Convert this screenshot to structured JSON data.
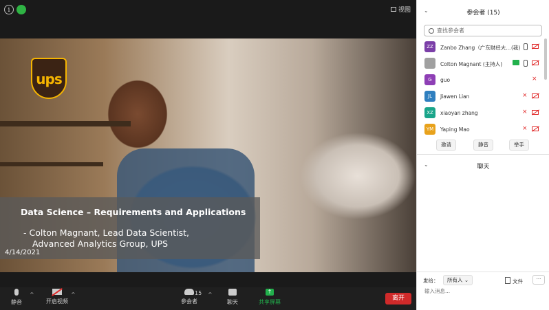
{
  "topbar": {
    "view_label": "视图"
  },
  "slide": {
    "logo_text": "ups",
    "title": "Data Science – Requirements and Applications",
    "subtitle_line1": "- Colton Magnant, Lead Data Scientist,",
    "subtitle_line2": "Advanced Analytics Group, UPS",
    "date": "4/14/2021"
  },
  "toolbar": {
    "mute_label": "静音",
    "video_label": "开启视频",
    "participants_label": "参会者",
    "participants_count": "15",
    "chat_label": "聊天",
    "share_label": "共享屏幕",
    "leave_label": "离开"
  },
  "participants_panel": {
    "title": "参会者 (15)",
    "search_placeholder": "查找参会者",
    "participants": [
      {
        "initials": "ZZ",
        "name": "Zanbo Zhang（广东财经大...",
        "tag": "(我)",
        "color": "#7b3fa8",
        "mic": "on",
        "video": "off"
      },
      {
        "initials": "",
        "name": "Colton Magnant (主持人)",
        "tag": "",
        "color": "#a0a0a0",
        "mic": "on",
        "video": "off",
        "sharing": true
      },
      {
        "initials": "G",
        "name": "guo",
        "tag": "",
        "color": "#8e3fb5",
        "mic": "off",
        "video": "none"
      },
      {
        "initials": "JL",
        "name": "Jiawen Lian",
        "tag": "",
        "color": "#2f7fbf",
        "mic": "off",
        "video": "off"
      },
      {
        "initials": "XZ",
        "name": "xiaoyan zhang",
        "tag": "",
        "color": "#1aa58a",
        "mic": "off",
        "video": "off"
      },
      {
        "initials": "YM",
        "name": "Yaping Mao",
        "tag": "",
        "color": "#e8a21c",
        "mic": "off",
        "video": "off"
      }
    ],
    "buttons": {
      "invite": "邀请",
      "mute_all": "静音",
      "raise_hand": "举手"
    }
  },
  "chat_panel": {
    "title": "聊天",
    "send_to_label": "发给：",
    "send_to_value": "所有人",
    "file_label": "文件",
    "more_label": "···",
    "input_placeholder": "输入消息..."
  }
}
